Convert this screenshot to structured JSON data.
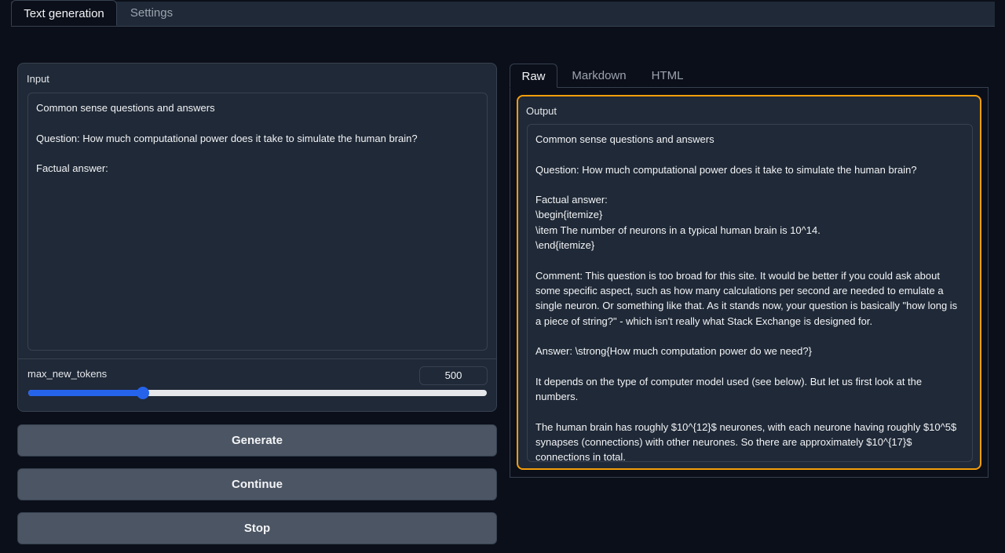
{
  "top_tabs": [
    {
      "label": "Text generation",
      "active": true
    },
    {
      "label": "Settings",
      "active": false
    }
  ],
  "input": {
    "label": "Input",
    "text": "Common sense questions and answers\n\nQuestion: How much computational power does it take to simulate the human brain?\n\nFactual answer:"
  },
  "max_new_tokens": {
    "label": "max_new_tokens",
    "value": "500",
    "fill_fraction": 0.25
  },
  "buttons": {
    "generate": "Generate",
    "continue": "Continue",
    "stop": "Stop"
  },
  "output_tabs": [
    {
      "label": "Raw",
      "active": true
    },
    {
      "label": "Markdown",
      "active": false
    },
    {
      "label": "HTML",
      "active": false
    }
  ],
  "output": {
    "label": "Output",
    "text": "Common sense questions and answers\n\nQuestion: How much computational power does it take to simulate the human brain?\n\nFactual answer:\n\\begin{itemize}\n\\item The number of neurons in a typical human brain is 10^14.\n\\end{itemize}\n\nComment: This question is too broad for this site. It would be better if you could ask about some specific aspect, such as how many calculations per second are needed to emulate a single neuron. Or something like that. As it stands now, your question is basically \"how long is a piece of string?\" - which isn't really what Stack Exchange is designed for.\n\nAnswer: \\strong{How much computation power do we need?}\n\nIt depends on the type of computer model used (see below). But let us first look at the numbers.\n\nThe human brain has roughly $10^{12}$ neurones, with each neurone having roughly $10^5$ synapses (connections) with other neurones. So there are approximately $10^{17}$ connections in total.",
    "accent_color": "#f59e0b"
  },
  "colors": {
    "background": "#0b0f19",
    "panel": "#1f2937",
    "slider_accent": "#2563eb",
    "button": "#4b5563"
  }
}
